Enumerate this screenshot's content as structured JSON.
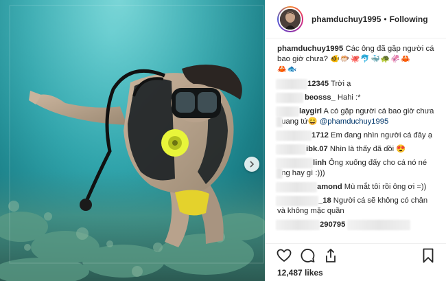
{
  "post": {
    "username": "phamduchuy1995",
    "separator": "•",
    "follow_status": "Following",
    "caption_text": "Các ông đã gặp người cá bao giờ chưa?",
    "caption_emojis": "🐠🐡🐙🐬🐳🐢🦑🦀",
    "caption_emojis_2": "🦀🐟"
  },
  "comments": [
    {
      "user": "12345",
      "text": " Trời ạ"
    },
    {
      "user": "beosss_",
      "text": " Hahi :*"
    },
    {
      "user": "laygirl",
      "text": " A có gặp người cá bao giờ chưa quang tứ",
      "emoji": "😄",
      "mention": " @phamduchuy1995"
    },
    {
      "user": "1712",
      "text": " Em đang nhìn người cá đây ạ"
    },
    {
      "user": "ibk.07",
      "text": " Nhìn là thấy đã dồi",
      "emoji": "😍"
    },
    {
      "user": "linh",
      "text": " Ông xuống đấy cho cá nó né ông hay gì :)))"
    },
    {
      "user": "amond",
      "text": " Mù mắt tôi rồi ông ơi =))"
    },
    {
      "user": "_18",
      "text": " Người cá sẽ không có chân và không mặc quần"
    },
    {
      "user": "290795",
      "text": ""
    }
  ],
  "actions": {
    "like_icon": "heart-icon",
    "comment_icon": "comment-icon",
    "share_icon": "share-icon",
    "save_icon": "bookmark-icon"
  },
  "likes": {
    "count": "12,487",
    "label": " likes"
  },
  "colors": {
    "water": "#2fa3aa",
    "mention": "#00376b",
    "text": "#262626"
  }
}
